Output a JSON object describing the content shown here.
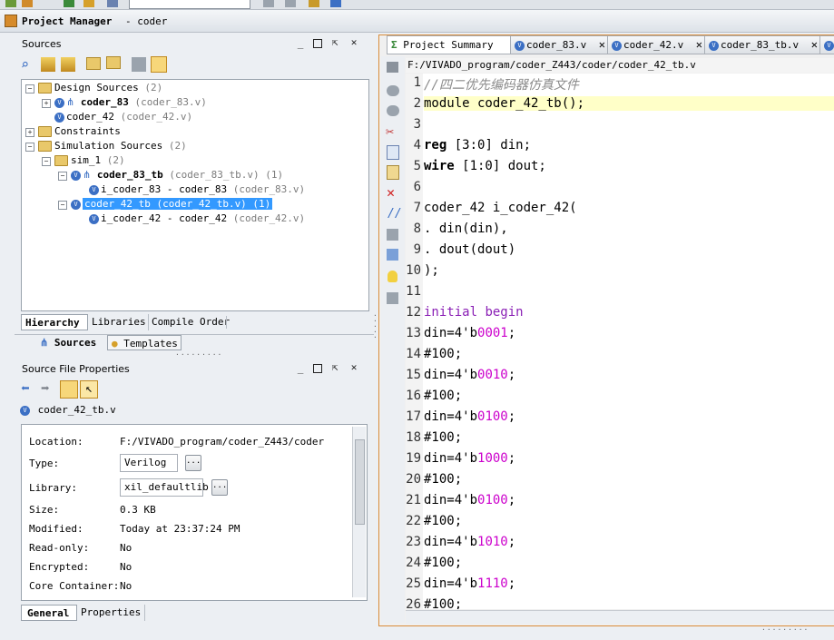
{
  "project_manager": {
    "title": "Project Manager",
    "project": "- coder"
  },
  "sources_panel": {
    "title": "Sources",
    "tree": [
      {
        "label": "Design Sources",
        "count": "(2)"
      },
      {
        "label": "coder_83",
        "detail": "(coder_83.v)"
      },
      {
        "label": "coder_42",
        "detail": "(coder_42.v)"
      },
      {
        "label": "Constraints"
      },
      {
        "label": "Simulation Sources",
        "count": "(2)"
      },
      {
        "label": "sim_1",
        "count": "(2)"
      },
      {
        "label": "coder_83_tb",
        "detail": "(coder_83_tb.v)",
        "count": "(1)"
      },
      {
        "label": "i_coder_83 - coder_83",
        "detail": "(coder_83.v)"
      },
      {
        "label": "coder_42_tb (coder_42_tb.v) (1)"
      },
      {
        "label": "i_coder_42 - coder_42",
        "detail": "(coder_42.v)"
      }
    ],
    "bottom_tabs": [
      "Hierarchy",
      "Libraries",
      "Compile Order"
    ],
    "view_tabs": [
      "Sources",
      "Templates"
    ]
  },
  "properties_panel": {
    "title": "Source File Properties",
    "file": "coder_42_tb.v",
    "fields": {
      "location_label": "Location:",
      "location": "F:/VIVADO_program/coder_Z443/coder",
      "type_label": "Type:",
      "type": "Verilog",
      "library_label": "Library:",
      "library": "xil_defaultlib",
      "size_label": "Size:",
      "size": "0.3 KB",
      "modified_label": "Modified:",
      "modified": "Today at 23:37:24 PM",
      "readonly_label": "Read-only:",
      "readonly": "No",
      "encrypted_label": "Encrypted:",
      "encrypted": "No",
      "core_label": "Core Container:",
      "core": "No",
      "dots": "..."
    },
    "tabs": [
      "General",
      "Properties"
    ]
  },
  "editor": {
    "tabs": [
      "Project Summary",
      "coder_83.v",
      "coder_42.v",
      "coder_83_tb.v"
    ],
    "path": "F:/VIVADO_program/coder_Z443/coder/coder_42_tb.v",
    "line_numbers": [
      "1",
      "2",
      "3",
      "4",
      "5",
      "6",
      "7",
      "8",
      "9",
      "10",
      "11",
      "12",
      "13",
      "14",
      "15",
      "16",
      "17",
      "18",
      "19",
      "20",
      "21",
      "22",
      "23",
      "24",
      "25",
      "26"
    ],
    "lines": [
      "//四二优先编码器仿真文件",
      "module coder_42_tb();",
      "",
      "reg [3:0] din;",
      "wire [1:0] dout;",
      "",
      "coder_42 i_coder_42(",
      ". din(din),",
      ". dout(dout)",
      ");",
      "",
      "initial begin",
      "din=4'b0001;",
      "#100;",
      "din=4'b0010;",
      "#100;",
      "din=4'b0100;",
      "#100;",
      "din=4'b1000;",
      "#100;",
      "din=4'b0100;",
      "#100;",
      "din=4'b1010;",
      "#100;",
      "din=4'b1110;",
      "#100;"
    ]
  },
  "colors": {
    "accent": "#d98c3a",
    "selection": "#3399ff",
    "keyword": "#8a1fb5",
    "number": "#cc00cc"
  }
}
